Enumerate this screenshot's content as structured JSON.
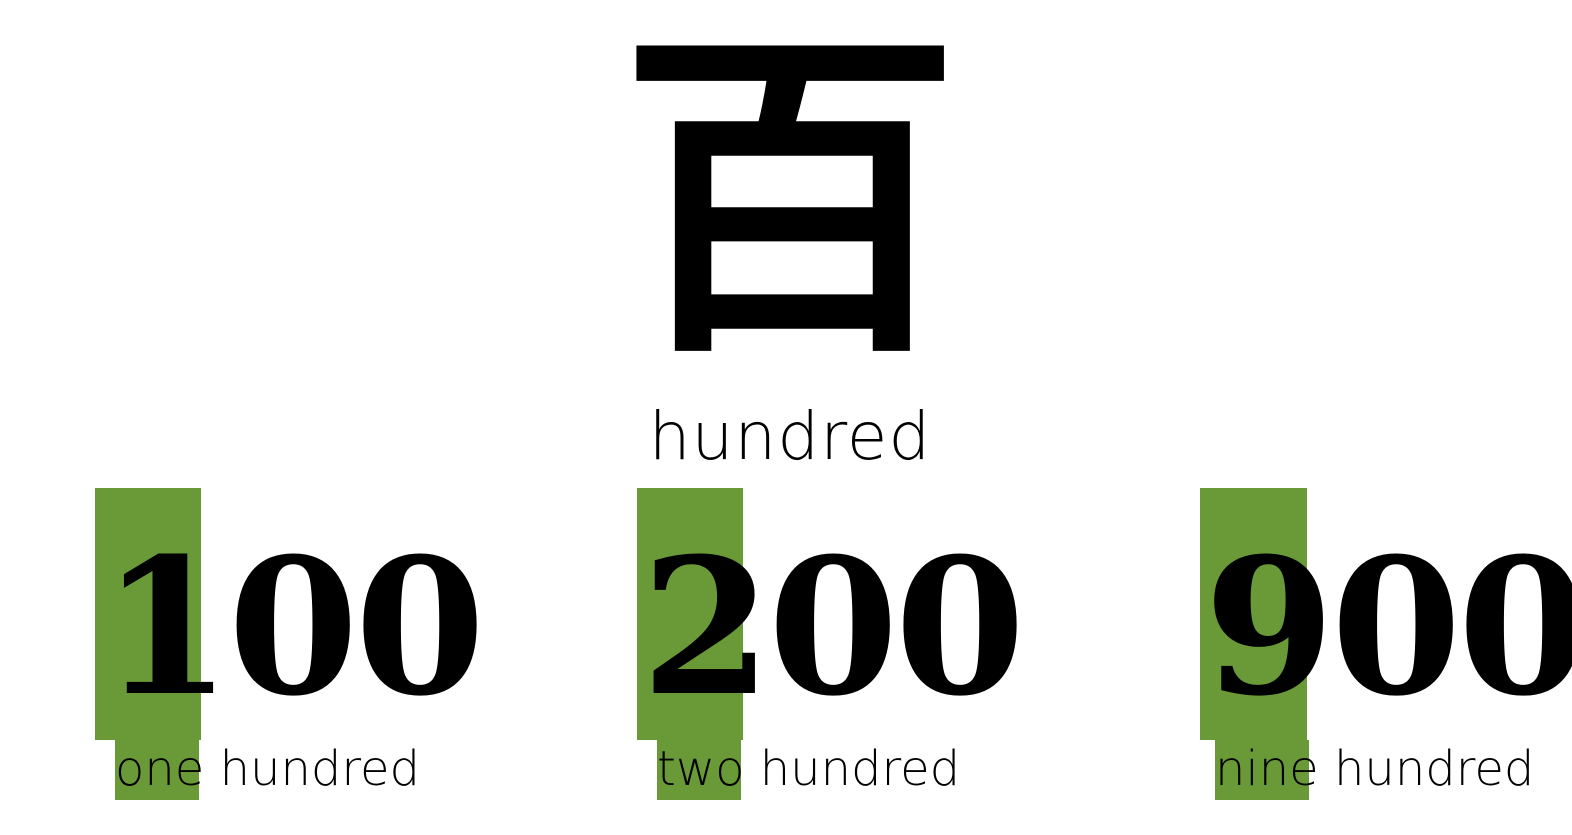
{
  "kanji": {
    "character": "百",
    "reading": "hundred"
  },
  "accent_color": "#6a9a38",
  "numbers": [
    {
      "lead_digit": "1",
      "rest_digits": "00",
      "multiplier_word": "one",
      "unit_word": "hundred"
    },
    {
      "lead_digit": "2",
      "rest_digits": "00",
      "multiplier_word": "two",
      "unit_word": "hundred"
    },
    {
      "lead_digit": "9",
      "rest_digits": "00",
      "multiplier_word": "nine",
      "unit_word": "hundred"
    }
  ]
}
